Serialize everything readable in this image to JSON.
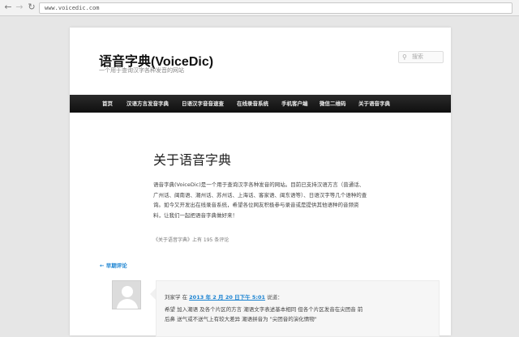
{
  "browser": {
    "url": "www.voicedic.com",
    "back_glyph": "←",
    "forward_glyph": "→",
    "reload_glyph": "↻"
  },
  "site": {
    "title": "语音字典(VoiceDic)",
    "description": "一个用于查询汉字各种发音的网站",
    "search_placeholder": "搜索",
    "search_glyph": "⚲"
  },
  "nav": {
    "items": [
      {
        "label": "首页"
      },
      {
        "label": "汉语方言发音字典"
      },
      {
        "label": "日语汉字音音速查"
      },
      {
        "label": "在线录音系统"
      },
      {
        "label": "手机客户端"
      },
      {
        "label": "微信二维码"
      },
      {
        "label": "关于语音字典"
      }
    ]
  },
  "article": {
    "title": "关于语音字典",
    "body": "语音字典(VoiceDic)是一个用于查询汉字各种发音的网站。目前已支持汉语方言（普通话、广州话、闽南语、潮州话、苏州话、上海话、客家语、闽东语等）、日语汉字等几个语种的查询。如今又开发出在线录音系统，希望各位网友积极参与录音或是提供其他语种的音频资料，让我们一起把语音字典做好来！",
    "meta": "《关于语音字典》上有 195 条评论"
  },
  "comments": {
    "heading": "← 早期评论",
    "first": {
      "author": "刘家学 在",
      "date": "2013 年 2 月 20 日下午 5:01",
      "said": "说道：",
      "text": "希望 加入潮语 及各个片区的方言 潮语文字表述基本相同 但各个片区发音在尖团音 前后鼻 送气或不送气上有较大差异 潮语拼音为 \"尖团音的演化情物\""
    }
  }
}
